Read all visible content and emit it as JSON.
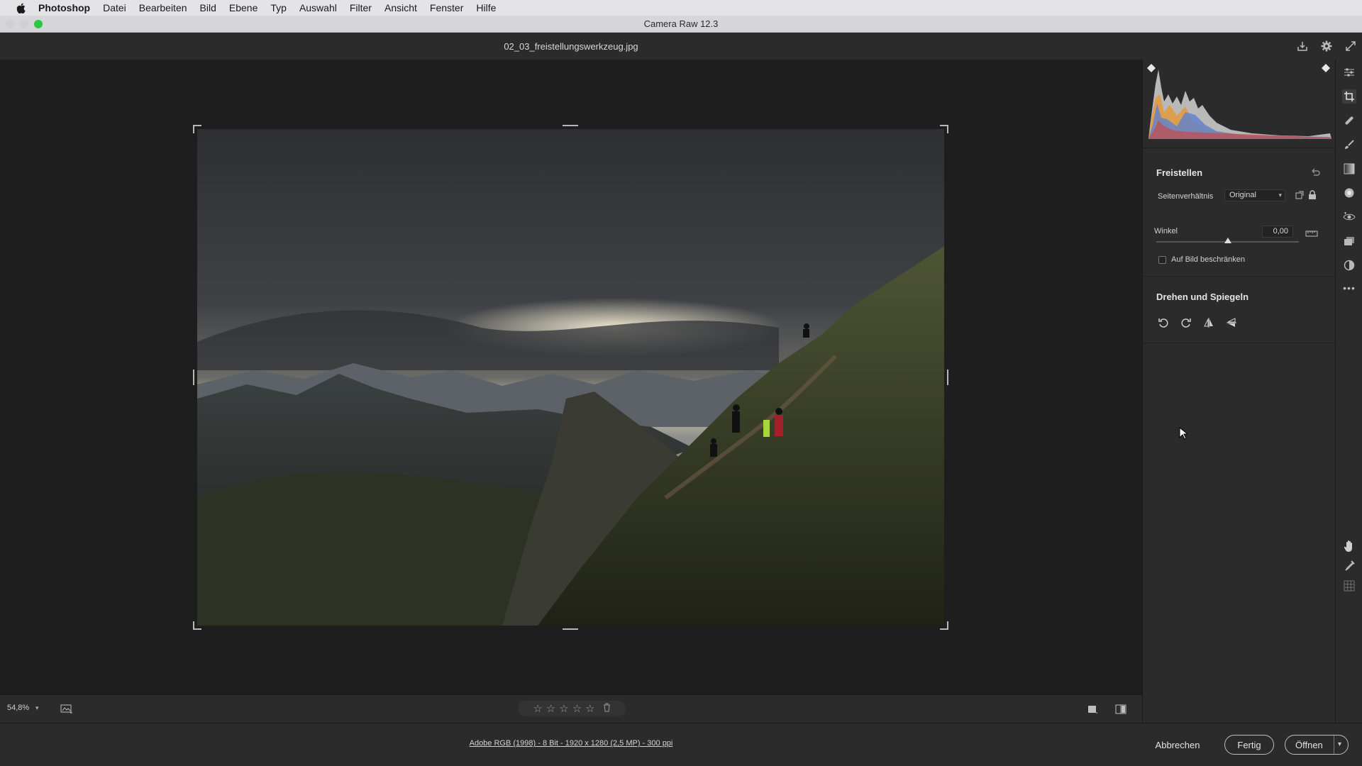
{
  "menubar": {
    "app_name": "Photoshop",
    "items": [
      "Datei",
      "Bearbeiten",
      "Bild",
      "Ebene",
      "Typ",
      "Auswahl",
      "Filter",
      "Ansicht",
      "Fenster",
      "Hilfe"
    ]
  },
  "window": {
    "title": "Camera Raw 12.3",
    "traffic_light_colors": [
      "#d0cfd2",
      "#d0cfd2",
      "#28c840"
    ]
  },
  "header": {
    "filename": "02_03_freistellungswerkzeug.jpg",
    "icons": [
      "save-icon",
      "settings-gear-icon",
      "fullscreen-icon"
    ]
  },
  "crop_panel": {
    "title": "Freistellen",
    "aspect_label": "Seitenverhältnis",
    "aspect_value": "Original",
    "angle_label": "Winkel",
    "angle_value": "0,00",
    "angle_slider_fraction": 0.5,
    "constrain_label": "Auf Bild beschränken",
    "constrain_checked": false
  },
  "rotate_panel": {
    "title": "Drehen und Spiegeln",
    "buttons": [
      "rotate-left-icon",
      "rotate-right-icon",
      "flip-horizontal-icon",
      "flip-vertical-icon"
    ]
  },
  "tools": [
    "edit-sliders-icon",
    "crop-icon",
    "healing-icon",
    "brush-icon",
    "gradient-icon",
    "radial-filter-icon",
    "red-eye-icon",
    "snapshots-icon",
    "presets-icon",
    "more-icon"
  ],
  "tools_bottom": [
    "hand-icon",
    "color-sampler-icon",
    "grid-icon"
  ],
  "bottombar": {
    "zoom": "54,8%",
    "rating_stars": 5,
    "rating_value": 0
  },
  "footer": {
    "info": "Adobe RGB (1998) - 8 Bit - 1920 x 1280 (2,5 MP) - 300 ppi",
    "cancel": "Abbrechen",
    "done": "Fertig",
    "open": "Öffnen"
  },
  "colors": {
    "ui_panel": "#2b2b2b",
    "canvas": "#1e1e1e",
    "accent_green": "#28c840"
  }
}
